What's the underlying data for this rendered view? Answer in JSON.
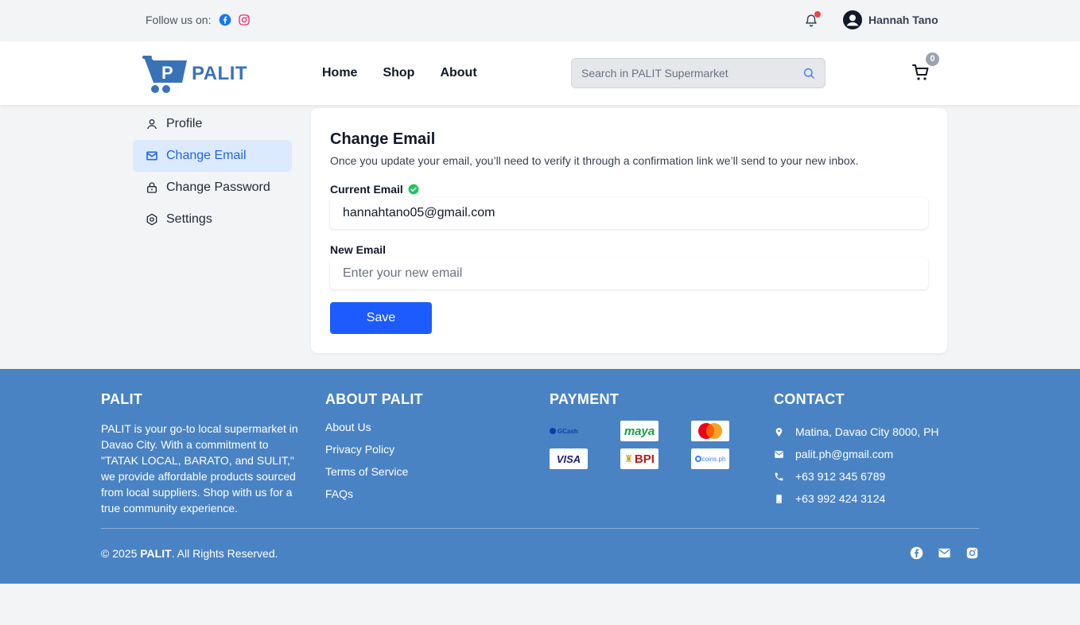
{
  "topbar": {
    "follow_label": "Follow us on:",
    "username": "Hannah Tano"
  },
  "header": {
    "logo_text": "PALIT",
    "nav": [
      "Home",
      "Shop",
      "About"
    ],
    "search_placeholder": "Search in PALIT Supermarket",
    "cart_count": "0"
  },
  "sidebar": {
    "items": [
      {
        "label": "Profile",
        "icon": "user-icon"
      },
      {
        "label": "Change Email",
        "icon": "mail-icon"
      },
      {
        "label": "Change Password",
        "icon": "lock-icon"
      },
      {
        "label": "Settings",
        "icon": "settings-icon"
      }
    ],
    "active": "Change Email"
  },
  "main": {
    "title": "Change Email",
    "description": "Once you update your email, you’ll need to verify it through a confirmation link we’ll send to your new inbox.",
    "current_label": "Current Email",
    "current_value": "hannahtano05@gmail.com",
    "new_label": "New Email",
    "new_placeholder": "Enter your new email",
    "save_label": "Save"
  },
  "footer": {
    "palit_heading": "PALIT",
    "palit_text": "PALIT is your go-to local supermarket in Davao City. With a commitment to \"TATAK LOCAL, BARATO, and SULIT,\" we provide affordable products sourced from local suppliers. Shop with us for a true community experience.",
    "about_heading": "ABOUT PALIT",
    "about_links": [
      "About Us",
      "Privacy Policy",
      "Terms of Service",
      "FAQs"
    ],
    "payment_heading": "PAYMENT",
    "payments": [
      "GCash",
      "maya",
      "",
      "VISA",
      "BPI",
      "coins.ph"
    ],
    "contact_heading": "CONTACT",
    "contact": {
      "address": "Matina, Davao City 8000, PH",
      "email": "palit.ph@gmail.com",
      "phone1": "+63 912 345 6789",
      "phone2": "+63 992 424 3124"
    },
    "copyright_prefix": "© 2025 ",
    "copyright_brand": "PALIT",
    "copyright_suffix": ". All Rights Reserved."
  },
  "colors": {
    "primary": "#1d5bff",
    "brand": "#3a72b8",
    "footer_bg": "#4a83c4",
    "active_bg": "#dbeafe",
    "verified": "#22c55e",
    "notification": "#ef4444"
  }
}
